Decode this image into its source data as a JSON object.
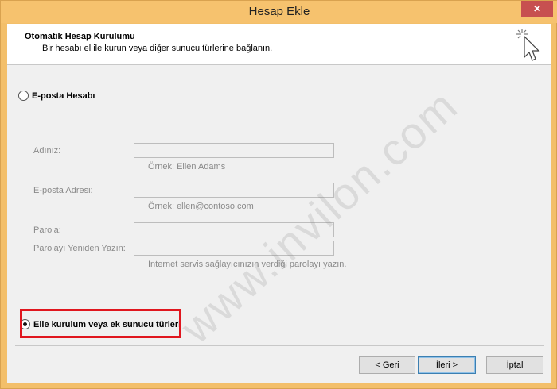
{
  "window": {
    "title": "Hesap Ekle",
    "close_glyph": "✕"
  },
  "header": {
    "title": "Otomatik Hesap Kurulumu",
    "subtitle": "Bir hesabı el ile kurun veya diğer sunucu türlerine bağlanın."
  },
  "options": {
    "email_account": {
      "label": "E-posta Hesabı",
      "selected": false
    },
    "manual_setup": {
      "label": "Elle kurulum veya ek sunucu türleri",
      "selected": true
    }
  },
  "form": {
    "name": {
      "label": "Adınız:",
      "value": "",
      "hint": "Örnek: Ellen Adams"
    },
    "email": {
      "label": "E-posta Adresi:",
      "value": "",
      "hint": "Örnek: ellen@contoso.com"
    },
    "password": {
      "label": "Parola:",
      "value": ""
    },
    "password_repeat": {
      "label": "Parolayı Yeniden Yazın:",
      "value": "",
      "hint": "Internet servis sağlayıcınızın verdiği parolayı yazın."
    }
  },
  "buttons": {
    "back": "< Geri",
    "next": "İleri >",
    "cancel": "İptal"
  },
  "watermark": "www.invilon.com",
  "colors": {
    "title_bar": "#f6c26e",
    "highlight_border": "#e0161e",
    "close_button": "#c75050"
  }
}
